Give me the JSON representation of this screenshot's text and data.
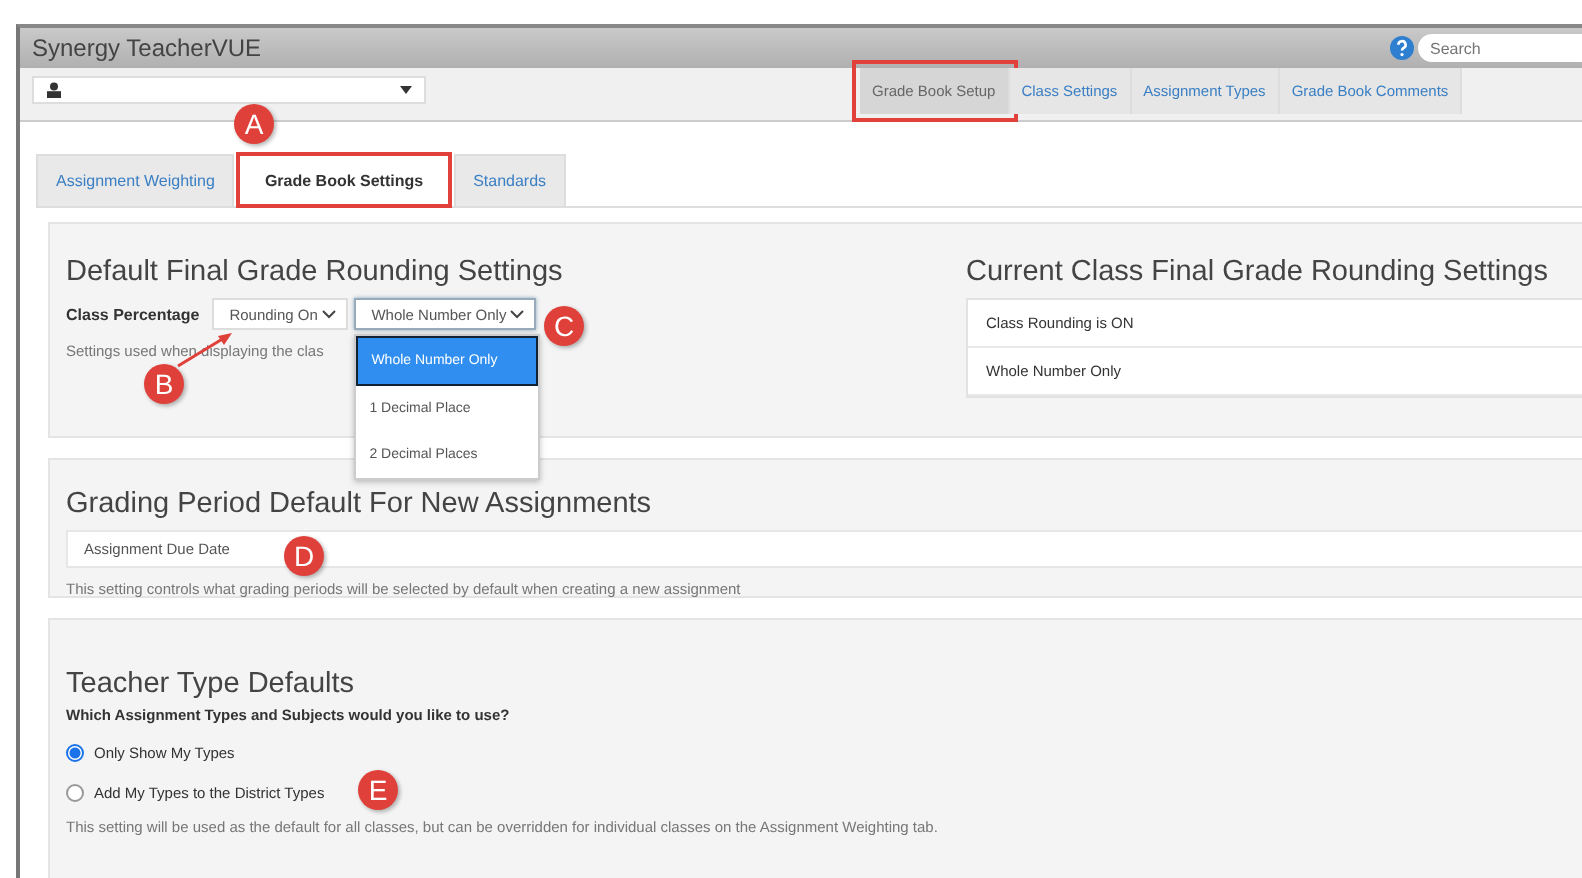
{
  "window": {
    "title": "Synergy TeacherVUE"
  },
  "search": {
    "placeholder": "Search"
  },
  "nav_tabs": [
    {
      "label": "Grade Book Setup",
      "selected": true,
      "highlighted": true
    },
    {
      "label": "Class Settings",
      "selected": false,
      "highlighted": false
    },
    {
      "label": "Assignment Types",
      "selected": false,
      "highlighted": false
    },
    {
      "label": "Grade Book Comments",
      "selected": false,
      "highlighted": false
    }
  ],
  "tabs": [
    {
      "label": "Assignment Weighting",
      "selected": false,
      "highlighted": false
    },
    {
      "label": "Grade Book Settings",
      "selected": true,
      "highlighted": true
    },
    {
      "label": "Standards",
      "selected": false,
      "highlighted": false
    }
  ],
  "rounding": {
    "title": "Default Final Grade Rounding Settings",
    "label": "Class Percentage",
    "rounding_select": "Rounding On",
    "precision_select": "Whole Number Only",
    "help": "Settings used when displaying the clas",
    "dropdown_options": [
      {
        "label": "Whole Number Only",
        "selected": true
      },
      {
        "label": "1 Decimal Place",
        "selected": false
      },
      {
        "label": "2 Decimal Places",
        "selected": false
      }
    ]
  },
  "current": {
    "title": "Current Class Final Grade Rounding Settings",
    "rows": [
      "Class Rounding is ON",
      "Whole Number Only"
    ]
  },
  "grading_period": {
    "title": "Grading Period Default For New Assignments",
    "value": "Assignment Due Date",
    "help": "This setting controls what grading periods will be selected by default when creating a new assignment"
  },
  "teacher_types": {
    "title": "Teacher Type Defaults",
    "question": "Which Assignment Types and Subjects would you like to use?",
    "options": [
      {
        "label": "Only Show My Types",
        "selected": true
      },
      {
        "label": "Add My Types to the District Types",
        "selected": false
      }
    ],
    "help": "This setting will be used as the default for all classes, but can be overridden for individual classes on the Assignment Weighting tab."
  },
  "annotations": [
    {
      "label": "A"
    },
    {
      "label": "B"
    },
    {
      "label": "C"
    },
    {
      "label": "D"
    },
    {
      "label": "E"
    }
  ]
}
